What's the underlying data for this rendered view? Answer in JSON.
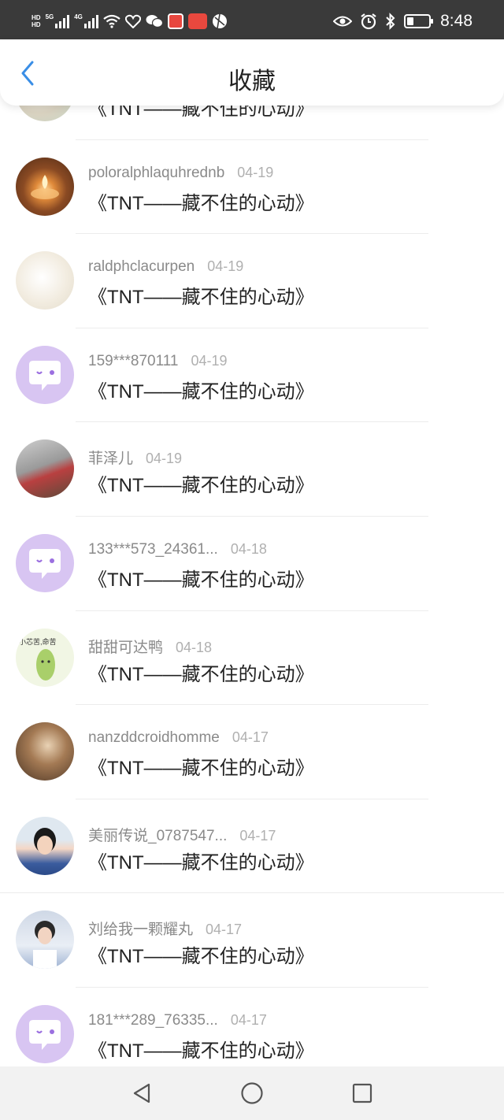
{
  "status_bar": {
    "hd_top": "HD",
    "hd_bottom": "HD",
    "net1": "5G",
    "net2": "4G",
    "time": "8:48",
    "icons": [
      "signal-icon",
      "wifi-icon",
      "heart-health-icon",
      "wechat-icon",
      "red-app-icon",
      "618-badge-icon",
      "ball-icon",
      "eye-icon",
      "alarm-icon",
      "bluetooth-icon",
      "battery-icon"
    ],
    "accent_colors": {
      "red_app": "#e8473f",
      "badge_618": "#e9483e"
    }
  },
  "header": {
    "title": "收藏",
    "back_icon": "chevron-left-icon",
    "back_color": "#3a8ee6"
  },
  "items": [
    {
      "name": "",
      "date": "",
      "text": "《TNT——藏不住的心动》",
      "avatar": "partial"
    },
    {
      "name": "poloralphlaquhrednb",
      "date": "04-19",
      "text": "《TNT——藏不住的心动》",
      "avatar": "candle"
    },
    {
      "name": "raldphclacurpen",
      "date": "04-19",
      "text": "《TNT——藏不住的心动》",
      "avatar": "cream"
    },
    {
      "name": "159***870111",
      "date": "04-19",
      "text": "《TNT——藏不住的心动》",
      "avatar": "default"
    },
    {
      "name": "菲泽儿",
      "date": "04-19",
      "text": "《TNT——藏不住的心动》",
      "avatar": "photo-sofa"
    },
    {
      "name": "133***573_24361...",
      "date": "04-18",
      "text": "《TNT——藏不住的心动》",
      "avatar": "default"
    },
    {
      "name": "甜甜可达鸭",
      "date": "04-18",
      "text": "《TNT——藏不住的心动》",
      "avatar": "cucumber"
    },
    {
      "name": "nanzddcroidhomme",
      "date": "04-17",
      "text": "《TNT——藏不住的心动》",
      "avatar": "room"
    },
    {
      "name": "美丽传说_0787547...",
      "date": "04-17",
      "text": "《TNT——藏不住的心动》",
      "avatar": "portrait-woman"
    },
    {
      "name": "刘给我一颗耀丸",
      "date": "04-17",
      "text": "《TNT——藏不住的心动》",
      "avatar": "portrait-boy"
    },
    {
      "name": "181***289_76335...",
      "date": "04-17",
      "text": "《TNT——藏不住的心动》",
      "avatar": "default"
    }
  ],
  "avatar_text": {
    "cucumber": "小芯苦,命苦"
  },
  "nav": {
    "back_icon": "triangle-back-icon",
    "home_icon": "circle-home-icon",
    "recent_icon": "square-recents-icon"
  },
  "colors": {
    "default_avatar_bg": "#d8c5f2",
    "default_avatar_fg": "#9b6fe0",
    "name_text": "#8a8a8a",
    "date_text": "#b0b0b0"
  }
}
